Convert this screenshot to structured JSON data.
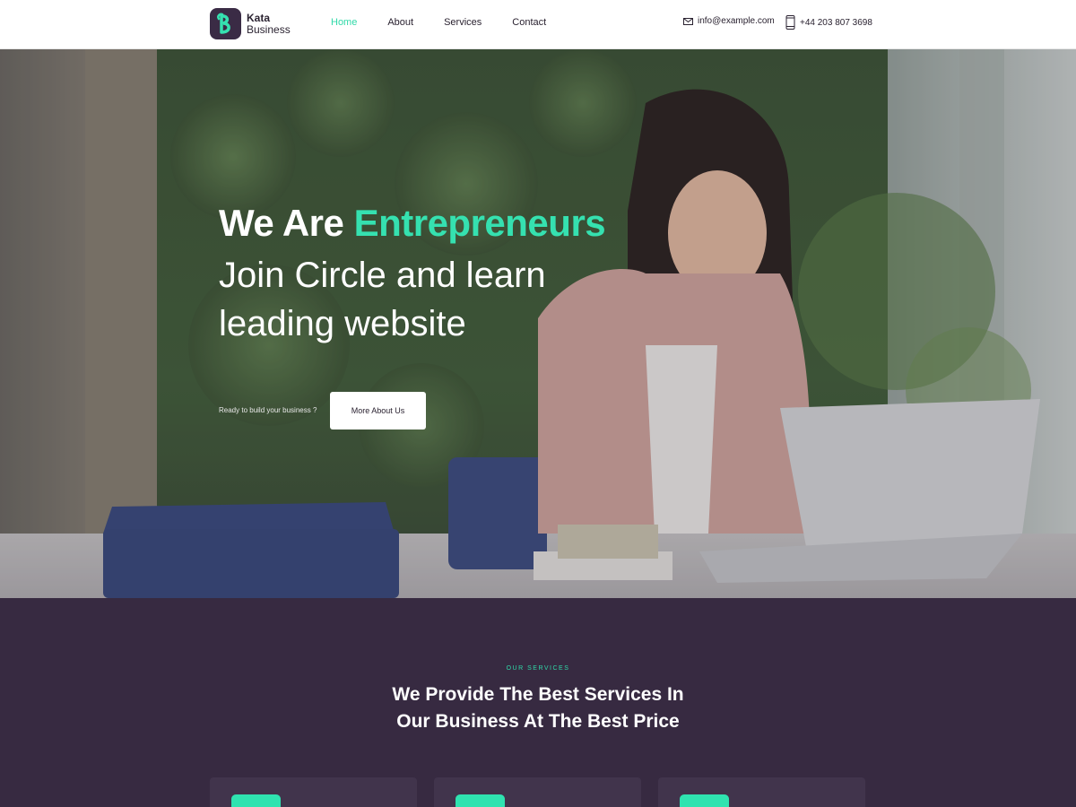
{
  "logo": {
    "line1": "Kata",
    "line2": "Business"
  },
  "nav": {
    "items": [
      {
        "label": "Home",
        "active": true
      },
      {
        "label": "About",
        "active": false
      },
      {
        "label": "Services",
        "active": false
      },
      {
        "label": "Contact",
        "active": false
      }
    ]
  },
  "contact": {
    "email": "info@example.com",
    "phone": "+44 203 807 3698"
  },
  "hero": {
    "title_plain": "We Are",
    "title_accent": "Entrepreneurs",
    "subtitle": "Join Circle and learn leading website",
    "question": "Ready to build your business ?",
    "button_label": "More About Us"
  },
  "services": {
    "eyebrow": "OUR SERVICES",
    "heading": "We Provide The Best Services In Our Business At The Best Price",
    "cards": [
      {},
      {},
      {}
    ]
  },
  "colors": {
    "accent": "#2fd9a8",
    "dark_purple": "#372a41",
    "card_purple": "#41344c",
    "text_dark": "#2a2230"
  }
}
